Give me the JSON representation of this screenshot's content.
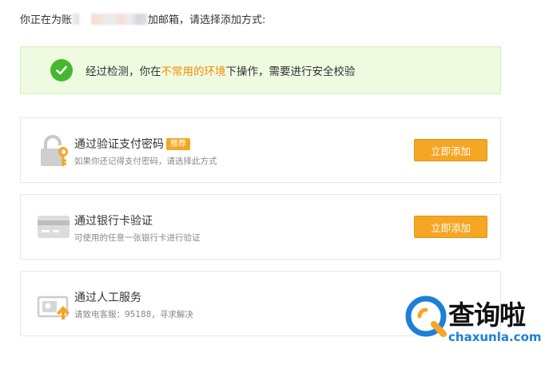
{
  "intro": {
    "prefix": "你正在为账",
    "suffix": "加邮箱，请选择添加方式:"
  },
  "notice": {
    "text_before": "经过检测，你在",
    "highlight": "不常用的环境",
    "text_after": "下操作，需要进行安全校验"
  },
  "options": [
    {
      "title": "通过验证支付密码",
      "badge": "推荐",
      "desc": "如果你还记得支付密码，请选择此方式",
      "button": "立即添加",
      "icon": "lock-key-icon"
    },
    {
      "title": "通过银行卡验证",
      "desc": "可使用的任意一张银行卡进行验证",
      "button": "立即添加",
      "icon": "bank-card-icon"
    },
    {
      "title": "通过人工服务",
      "desc": "请致电客服：95188，寻求解决",
      "icon": "id-card-upload-icon"
    }
  ],
  "watermark": {
    "name": "查询啦",
    "url": "chaxunla.com"
  },
  "colors": {
    "accent": "#f5a623",
    "highlight": "#f28c00",
    "success": "#46b82f",
    "brand_blue": "#1e7fd8"
  }
}
